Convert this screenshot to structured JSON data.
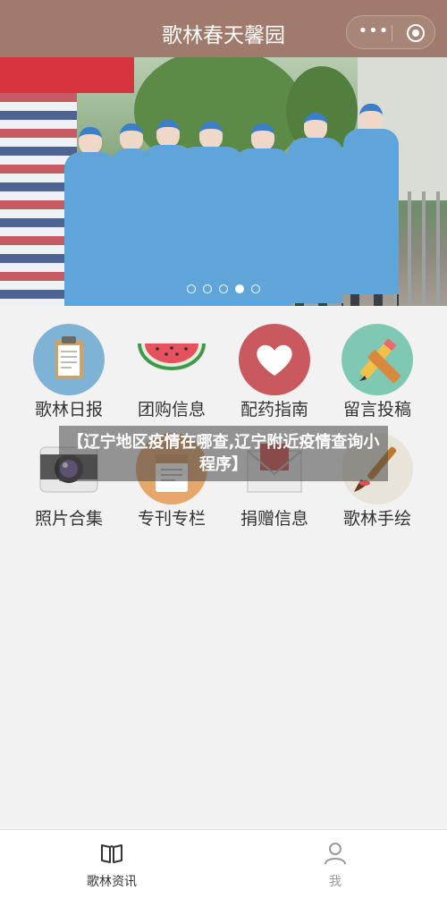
{
  "header": {
    "title": "歌林春天馨园",
    "menu_icon": "more-dots-icon",
    "close_icon": "target-circle-icon"
  },
  "banner": {
    "description_icon": "carousel-photo",
    "dot_count": 5,
    "active_dot": 3
  },
  "grid": {
    "items": [
      {
        "label": "歌林日报",
        "icon": "clipboard-icon",
        "color": "#7fb3d5"
      },
      {
        "label": "团购信息",
        "icon": "watermelon-icon",
        "color": "#f2f2f2"
      },
      {
        "label": "配药指南",
        "icon": "heart-icon",
        "color": "#c9585f"
      },
      {
        "label": "留言投稿",
        "icon": "pencil-icon",
        "color": "#7fc8b4"
      },
      {
        "label": "照片合集",
        "icon": "camera-icon",
        "color": "#f2f2f2"
      },
      {
        "label": "专刊专栏",
        "icon": "document-icon",
        "color": "#e7a76b"
      },
      {
        "label": "捐赠信息",
        "icon": "envelope-icon",
        "color": "#f2f2f2"
      },
      {
        "label": "歌林手绘",
        "icon": "brush-icon",
        "color": "#e8e4da"
      }
    ]
  },
  "watermark": {
    "text": "【辽宁地区疫情在哪查,辽宁附近疫情查询小程序】"
  },
  "tabbar": {
    "tabs": [
      {
        "label": "歌林资讯",
        "icon": "book-icon",
        "active": true
      },
      {
        "label": "我",
        "icon": "user-icon",
        "active": false
      }
    ]
  },
  "colors": {
    "header_bg": "#a07a6a",
    "page_bg": "#f2f2f2",
    "tab_active": "#333333",
    "tab_inactive": "#999999"
  }
}
